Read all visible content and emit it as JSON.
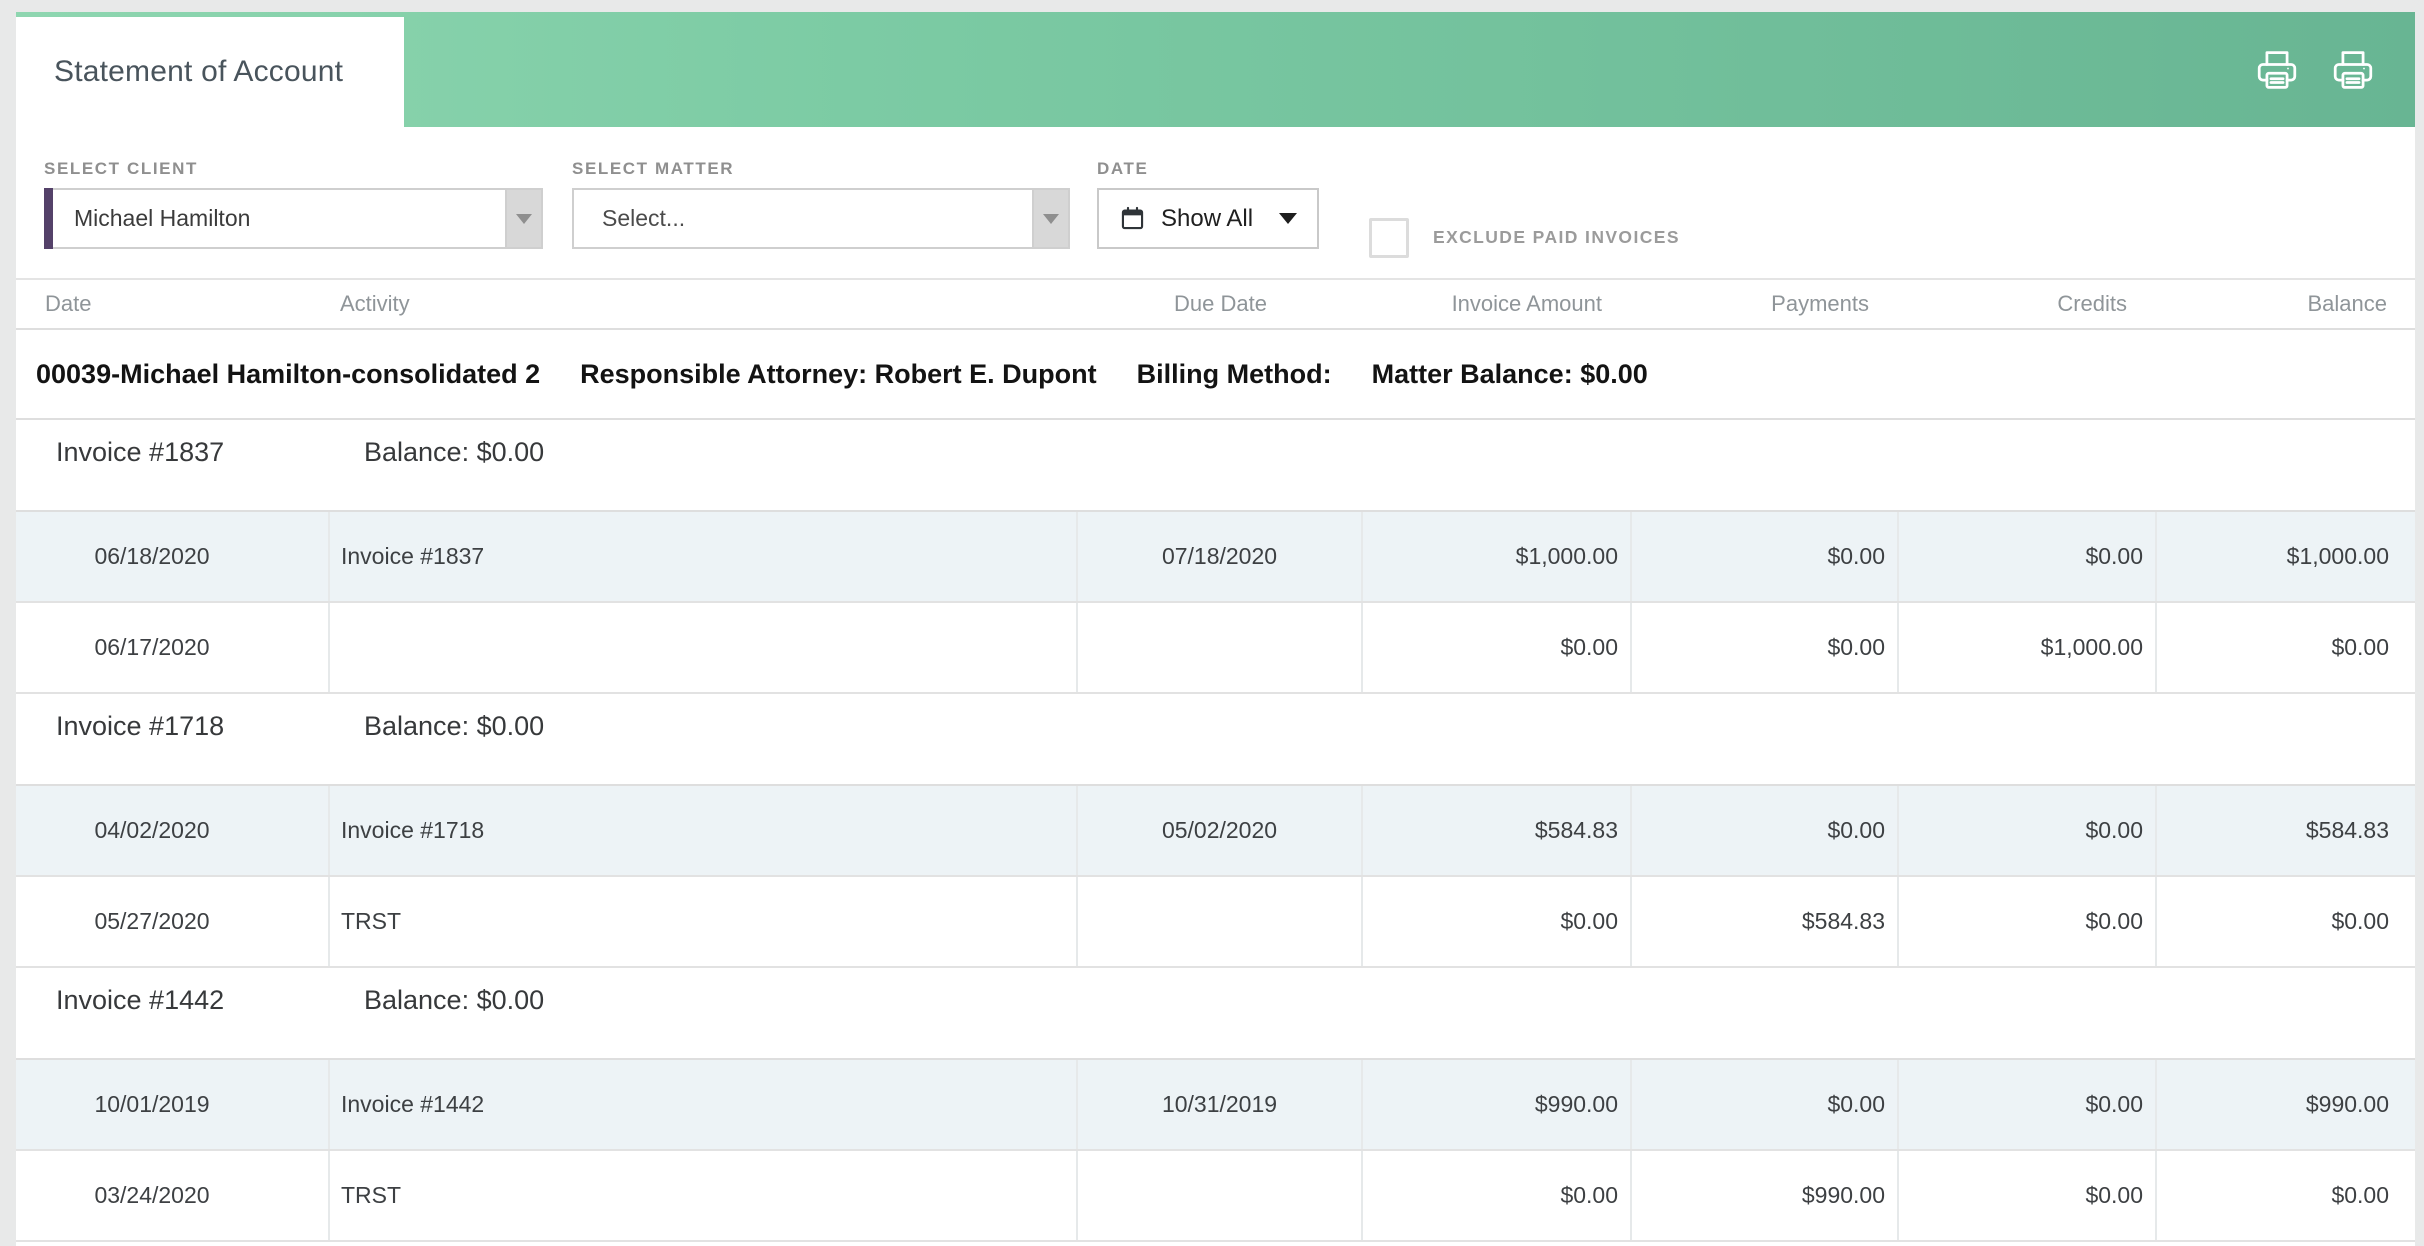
{
  "header": {
    "tab_title": "Statement of Account",
    "icons": {
      "print_1": "printer-icon",
      "print_2": "printer-icon"
    },
    "colors": {
      "bar_gradient_start": "#8ED6B0",
      "bar_gradient_end": "#68B593"
    }
  },
  "filters": {
    "client": {
      "label": "SELECT CLIENT",
      "value": "Michael Hamilton",
      "accent_color": "#544169"
    },
    "matter": {
      "label": "SELECT MATTER",
      "value": "Select..."
    },
    "date": {
      "label": "DATE",
      "value": "Show All"
    },
    "exclude_paid": {
      "label": "EXCLUDE PAID INVOICES",
      "checked": false
    }
  },
  "table": {
    "columns": [
      "Date",
      "Activity",
      "Due Date",
      "Invoice Amount",
      "Payments",
      "Credits",
      "Balance"
    ],
    "matter_header": {
      "matter_name": "00039-Michael Hamilton-consolidated 2",
      "responsible_attorney": "Responsible Attorney: Robert E. Dupont",
      "billing_method": "Billing Method:",
      "matter_balance": "Matter Balance: $0.00"
    },
    "groups": [
      {
        "title": "Invoice #1837",
        "balance": "Balance: $0.00",
        "rows": [
          {
            "date": "06/18/2020",
            "activity": "Invoice #1837",
            "due": "07/18/2020",
            "amount": "$1,000.00",
            "payments": "$0.00",
            "credits": "$0.00",
            "balance": "$1,000.00"
          },
          {
            "date": "06/17/2020",
            "activity": "",
            "due": "",
            "amount": "$0.00",
            "payments": "$0.00",
            "credits": "$1,000.00",
            "balance": "$0.00"
          }
        ]
      },
      {
        "title": "Invoice #1718",
        "balance": "Balance: $0.00",
        "rows": [
          {
            "date": "04/02/2020",
            "activity": "Invoice #1718",
            "due": "05/02/2020",
            "amount": "$584.83",
            "payments": "$0.00",
            "credits": "$0.00",
            "balance": "$584.83"
          },
          {
            "date": "05/27/2020",
            "activity": "TRST",
            "due": "",
            "amount": "$0.00",
            "payments": "$584.83",
            "credits": "$0.00",
            "balance": "$0.00"
          }
        ]
      },
      {
        "title": "Invoice #1442",
        "balance": "Balance: $0.00",
        "rows": [
          {
            "date": "10/01/2019",
            "activity": "Invoice #1442",
            "due": "10/31/2019",
            "amount": "$990.00",
            "payments": "$0.00",
            "credits": "$0.00",
            "balance": "$990.00"
          },
          {
            "date": "03/24/2020",
            "activity": "TRST",
            "due": "",
            "amount": "$0.00",
            "payments": "$990.00",
            "credits": "$0.00",
            "balance": "$0.00"
          }
        ]
      }
    ]
  }
}
